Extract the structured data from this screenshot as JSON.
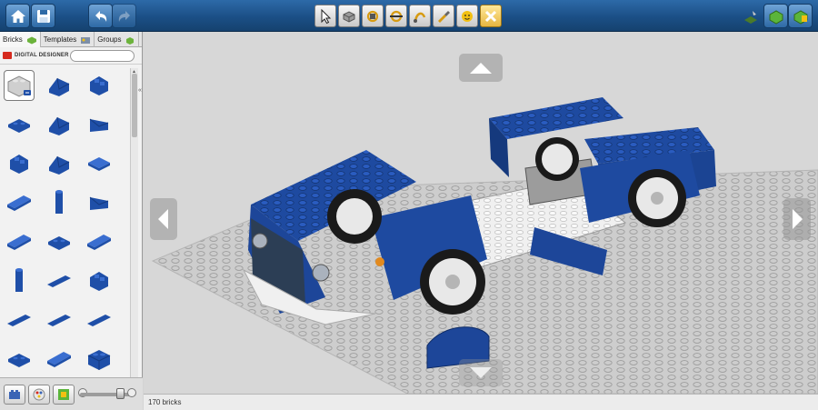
{
  "toolbar": {
    "left_buttons": [
      "home-icon",
      "save-icon",
      "undo-icon",
      "redo-icon"
    ],
    "tools": [
      "select-icon",
      "clone-icon",
      "hinge-icon",
      "hinge-align-icon",
      "flex-icon",
      "paint-icon",
      "decorate-icon",
      "delete-icon"
    ],
    "active_tool": "delete-icon",
    "right_buttons": [
      "build-mode-icon",
      "view-mode-icon",
      "building-guide-icon"
    ]
  },
  "sidebar": {
    "tabs": [
      {
        "label": "Bricks",
        "icon": "brick-icon"
      },
      {
        "label": "Templates",
        "icon": "template-icon"
      },
      {
        "label": "Groups",
        "icon": "group-icon"
      }
    ],
    "brand": "DIGITAL DESIGNER",
    "search": {
      "value": "",
      "placeholder": ""
    }
  },
  "colors": {
    "brick_blue": "#1f4fa8",
    "brick_white": "#f2f2f2",
    "toolbar_blue": "#1b4f86",
    "grid_gray": "#c6c6c6"
  },
  "status": {
    "brick_count": "170 bricks"
  }
}
